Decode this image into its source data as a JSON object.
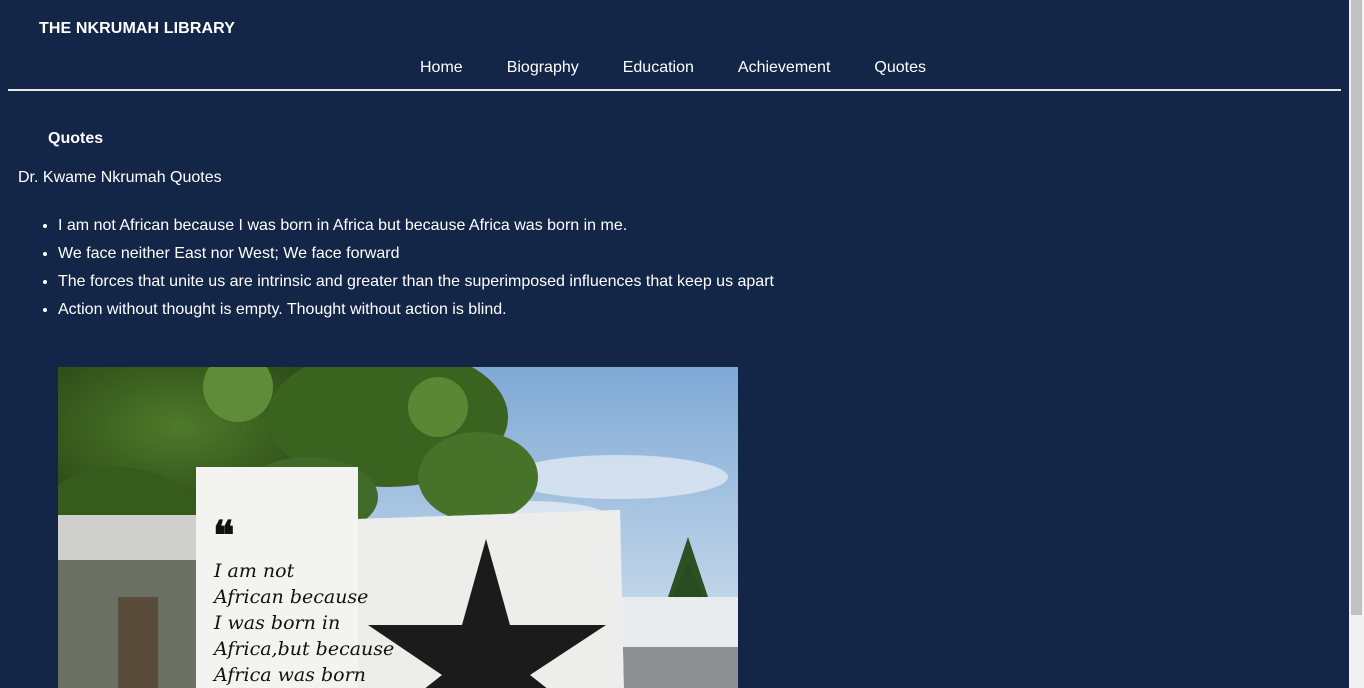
{
  "header": {
    "brand": "THE NKRUMAH LIBRARY"
  },
  "nav": {
    "items": [
      {
        "label": "Home"
      },
      {
        "label": "Biography"
      },
      {
        "label": "Education"
      },
      {
        "label": "Achievement"
      },
      {
        "label": "Quotes"
      }
    ]
  },
  "main": {
    "section_title": "Quotes",
    "subtitle": "Dr. Kwame Nkrumah Quotes",
    "quotes": [
      "I am not African because I was born in Africa but because Africa was born in me.",
      "We face neither East nor West; We face forward",
      "The forces that unite us are intrinsic and greater than the superimposed influences that keep us apart",
      "Action without thought is empty. Thought without action is blind."
    ],
    "image": {
      "quote_lines": [
        "I am not",
        "African because",
        "I was born in",
        "Africa,but because",
        "Africa was born"
      ],
      "quote_mark": "❝"
    }
  },
  "colors": {
    "background": "#132647",
    "text": "#ffffff",
    "divider": "#e6e6e6"
  }
}
